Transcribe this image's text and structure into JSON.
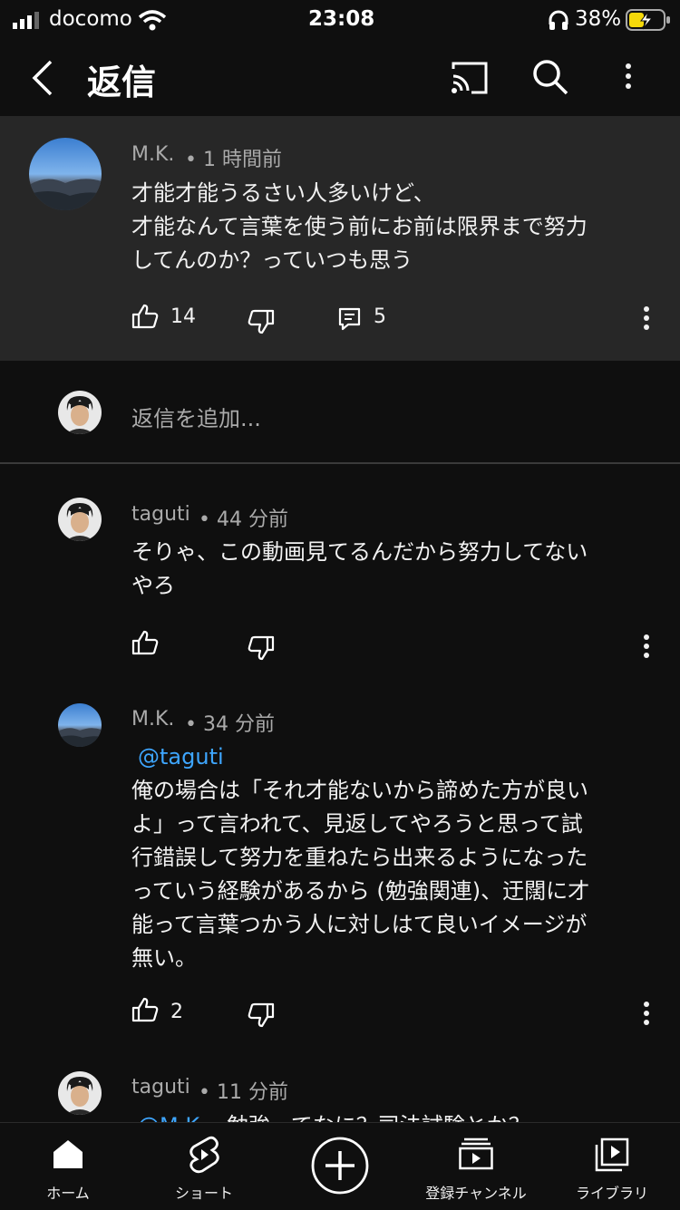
{
  "status_bar": {
    "carrier": "docomo",
    "time": "23:08",
    "battery": "38%"
  },
  "header": {
    "title": "返信",
    "icons": [
      "back-icon",
      "cast-icon",
      "search-icon",
      "more-vert-icon"
    ]
  },
  "main_comment": {
    "author": "M.K.",
    "time": "• 1 時間前",
    "text": "才能才能うるさい人多いけど、\n才能なんて言葉を使う前にお前は限界まで努力\nしてんのか？っていつも思う",
    "likes": "14",
    "replies": "5"
  },
  "reply_input": {
    "placeholder": "返信を追加..."
  },
  "replies": [
    {
      "author": "taguti",
      "time": "• 44 分前",
      "mention": "",
      "text": "そりゃ、この動画見てるんだから努力してない\nやろ",
      "likes": ""
    },
    {
      "author": "M.K.",
      "time": "• 34 分前",
      "mention": "@taguti",
      "text": "俺の場合は「それ才能ないから諦めた方が良い\nよ」って言われて、見返してやろうと思って試\n行錯誤して努力を重ねたら出来るようになった\nっていう経験があるから (勉強関連)、迂闊に才\n能って言葉つかう人に対しはて良いイメージが\n無い。",
      "likes": "2"
    },
    {
      "author": "taguti",
      "time": "• 11 分前",
      "mention": "@M.K.",
      "text": "勉強ってなに？司法試験とか？",
      "likes": ""
    }
  ],
  "bottom_nav": {
    "items": [
      {
        "label": "ホーム",
        "icon": "home-icon"
      },
      {
        "label": "ショート",
        "icon": "shorts-icon"
      },
      {
        "label": "",
        "icon": "create-icon"
      },
      {
        "label": "登録チャンネル",
        "icon": "subscriptions-icon"
      },
      {
        "label": "ライブラリ",
        "icon": "library-icon"
      }
    ]
  },
  "colors": {
    "background": "#0f0f0f",
    "highlight": "#272727",
    "mention": "#3ea6ff",
    "battery_charging": "#f5d90a"
  }
}
